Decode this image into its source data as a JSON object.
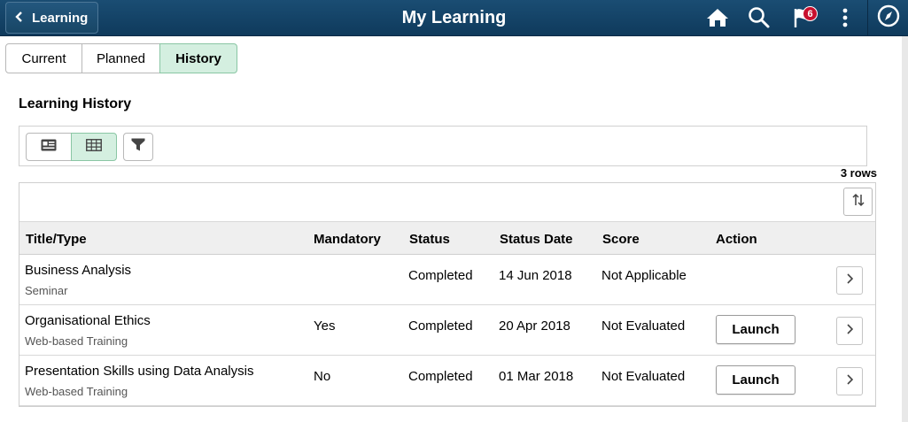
{
  "header": {
    "back_label": "Learning",
    "title": "My Learning",
    "notification_count": "6",
    "icons": [
      "home-icon",
      "search-icon",
      "flag-icon",
      "more-vertical-icon",
      "compass-icon"
    ]
  },
  "tabs": [
    {
      "label": "Current",
      "active": false
    },
    {
      "label": "Planned",
      "active": false
    },
    {
      "label": "History",
      "active": true
    }
  ],
  "section_title": "Learning History",
  "toolbar": {
    "views": [
      "card-view-icon",
      "grid-view-icon"
    ],
    "active_view": "grid-view-icon",
    "filter_icon": "filter-icon"
  },
  "row_count": "3 rows",
  "table": {
    "columns": [
      "Title/Type",
      "Mandatory",
      "Status",
      "Status Date",
      "Score",
      "Action"
    ],
    "rows": [
      {
        "title": "Business Analysis",
        "type": "Seminar",
        "mandatory": "",
        "status": "Completed",
        "date": "14 Jun 2018",
        "score": "Not Applicable",
        "action": ""
      },
      {
        "title": "Organisational Ethics",
        "type": "Web-based Training",
        "mandatory": "Yes",
        "status": "Completed",
        "date": "20 Apr 2018",
        "score": "Not Evaluated",
        "action": "Launch"
      },
      {
        "title": "Presentation Skills using Data Analysis",
        "type": "Web-based Training",
        "mandatory": "No",
        "status": "Completed",
        "date": "01 Mar 2018",
        "score": "Not Evaluated",
        "action": "Launch"
      }
    ]
  },
  "colors": {
    "header_bg": "#1a4d73",
    "active_tab_bg": "#d4efe0",
    "badge": "#c8102e"
  }
}
